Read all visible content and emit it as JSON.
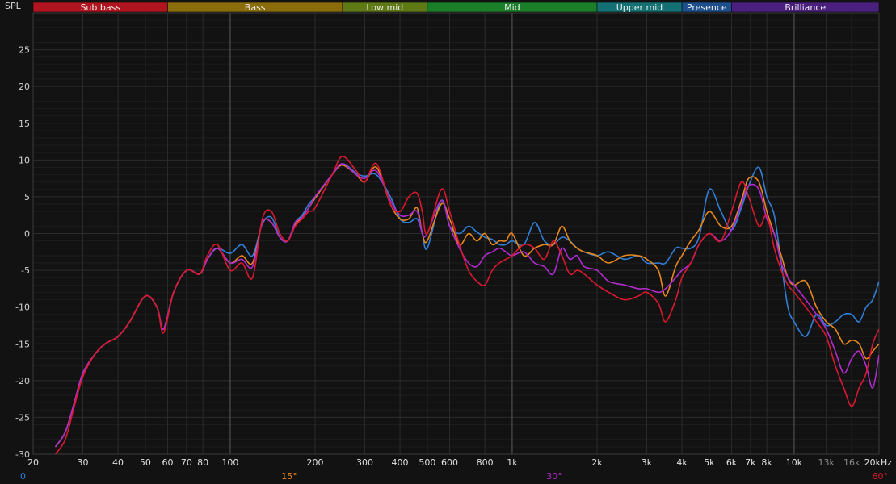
{
  "chart_data": {
    "type": "line",
    "ylabel": "SPL",
    "xlabel": "",
    "xscale": "log",
    "xlim": [
      20,
      20000
    ],
    "ylim": [
      -30,
      30
    ],
    "grid": true,
    "y_ticks": [
      25,
      20,
      15,
      10,
      5,
      0,
      -5,
      -10,
      -15,
      -20,
      -25,
      -30
    ],
    "x_ticks": [
      {
        "f": 20,
        "label": "20"
      },
      {
        "f": 30,
        "label": "30"
      },
      {
        "f": 40,
        "label": "40"
      },
      {
        "f": 50,
        "label": "50"
      },
      {
        "f": 60,
        "label": "60"
      },
      {
        "f": 70,
        "label": "70"
      },
      {
        "f": 80,
        "label": "80"
      },
      {
        "f": 100,
        "label": "100"
      },
      {
        "f": 200,
        "label": "200"
      },
      {
        "f": 300,
        "label": "300"
      },
      {
        "f": 400,
        "label": "400"
      },
      {
        "f": 500,
        "label": "500"
      },
      {
        "f": 600,
        "label": "600"
      },
      {
        "f": 800,
        "label": "800"
      },
      {
        "f": 1000,
        "label": "1k"
      },
      {
        "f": 2000,
        "label": "2k"
      },
      {
        "f": 3000,
        "label": "3k"
      },
      {
        "f": 4000,
        "label": "4k"
      },
      {
        "f": 5000,
        "label": "5k"
      },
      {
        "f": 6000,
        "label": "6k"
      },
      {
        "f": 7000,
        "label": "7k"
      },
      {
        "f": 8000,
        "label": "8k"
      },
      {
        "f": 10000,
        "label": "10k"
      },
      {
        "f": 13000,
        "label": "13k"
      },
      {
        "f": 16000,
        "label": "16k"
      },
      {
        "f": 20000,
        "label": "20kHz"
      }
    ],
    "bands": [
      {
        "label": "Sub bass",
        "from": 20,
        "to": 60,
        "color": "#b0141e"
      },
      {
        "label": "Bass",
        "from": 60,
        "to": 250,
        "color": "#8a6d0a"
      },
      {
        "label": "Low mid",
        "from": 250,
        "to": 500,
        "color": "#5f7a14"
      },
      {
        "label": "Mid",
        "from": 500,
        "to": 2000,
        "color": "#1b7f2a"
      },
      {
        "label": "Upper mid",
        "from": 2000,
        "to": 4000,
        "color": "#137073"
      },
      {
        "label": "Presence",
        "from": 4000,
        "to": 6000,
        "color": "#1c4f8c"
      },
      {
        "label": "Brilliance",
        "from": 6000,
        "to": 20000,
        "color": "#4a1f7e"
      }
    ],
    "legend": [
      {
        "label": "0",
        "color": "#2f7fd8"
      },
      {
        "label": "15°",
        "color": "#e8871a"
      },
      {
        "label": "30°",
        "color": "#b22ad0"
      },
      {
        "label": "60°",
        "color": "#d9192e"
      }
    ],
    "series": [
      {
        "color": "#2f7fd8",
        "x": [
          24,
          26,
          28,
          30,
          33,
          36,
          40,
          44,
          50,
          55,
          58,
          63,
          70,
          78,
          83,
          90,
          100,
          110,
          120,
          130,
          140,
          150,
          160,
          170,
          180,
          190,
          200,
          230,
          250,
          280,
          300,
          330,
          370,
          400,
          430,
          460,
          480,
          500,
          560,
          600,
          650,
          700,
          750,
          800,
          850,
          900,
          950,
          1000,
          1100,
          1200,
          1300,
          1400,
          1500,
          1600,
          1700,
          1800,
          2000,
          2200,
          2500,
          2800,
          3000,
          3300,
          3500,
          3800,
          4000,
          4300,
          4600,
          5000,
          5500,
          6000,
          6500,
          6900,
          7500,
          8000,
          8500,
          9000,
          9500,
          10000,
          11000,
          12000,
          13000,
          14000,
          15000,
          16000,
          17000,
          18000,
          19000,
          20000
        ],
        "y": [
          -29,
          -27,
          -23,
          -19,
          -16.5,
          -15,
          -14,
          -12,
          -8.5,
          -10,
          -13,
          -8,
          -5,
          -5.5,
          -3.5,
          -2,
          -2.7,
          -1.5,
          -3,
          1.3,
          2.2,
          -0.5,
          -1,
          1.5,
          2.5,
          4,
          5,
          8,
          9.5,
          8.2,
          7.8,
          8,
          5,
          2,
          1.5,
          2,
          0,
          -2,
          4.5,
          1,
          0,
          1,
          0.2,
          -0.5,
          -0.8,
          -1.5,
          -1.5,
          -1,
          -1.5,
          1.5,
          -1,
          -1.5,
          -0.5,
          -1,
          -2,
          -2.5,
          -3,
          -2.5,
          -3.5,
          -3,
          -4,
          -4,
          -4,
          -2,
          -2,
          -2,
          -0.5,
          6,
          3,
          0.5,
          3.5,
          6.5,
          9,
          5,
          2.5,
          -4,
          -10,
          -12,
          -14,
          -11,
          -12.5,
          -12,
          -11,
          -11,
          -12,
          -10,
          -9,
          -6.5
        ]
      },
      {
        "color": "#e8871a",
        "x": [
          24,
          26,
          28,
          30,
          33,
          36,
          40,
          44,
          50,
          55,
          58,
          63,
          70,
          78,
          83,
          90,
          100,
          110,
          120,
          130,
          140,
          150,
          160,
          170,
          180,
          190,
          200,
          230,
          250,
          280,
          300,
          330,
          370,
          400,
          430,
          460,
          480,
          500,
          560,
          600,
          650,
          700,
          750,
          800,
          850,
          900,
          950,
          1000,
          1100,
          1200,
          1300,
          1400,
          1500,
          1600,
          1700,
          1800,
          2000,
          2200,
          2500,
          2800,
          3000,
          3300,
          3500,
          3800,
          4000,
          4300,
          4600,
          5000,
          5500,
          6000,
          6500,
          6900,
          7500,
          8000,
          8500,
          9000,
          9500,
          10000,
          11000,
          12000,
          13000,
          14000,
          15000,
          16000,
          17000,
          18000,
          19000,
          20000
        ],
        "y": [
          -29,
          -27,
          -23,
          -19,
          -16.5,
          -15,
          -14,
          -12,
          -8.5,
          -10,
          -13,
          -8,
          -5,
          -5.5,
          -3.5,
          -2,
          -4,
          -3,
          -4,
          1.5,
          1.5,
          -0.5,
          -1,
          1.2,
          2.2,
          3.5,
          4.8,
          8,
          9.3,
          8,
          7,
          9,
          4,
          2,
          2,
          3.5,
          0,
          -1,
          4,
          2,
          -1.5,
          0,
          -1,
          0,
          -1.5,
          -1,
          -1,
          0,
          -3,
          -2,
          -1.5,
          -1.5,
          1,
          -1,
          -2,
          -2.5,
          -3,
          -4,
          -3,
          -3,
          -3.5,
          -5,
          -8.5,
          -4.5,
          -3,
          -1,
          0.5,
          3,
          1,
          1,
          4.5,
          7.5,
          7,
          3,
          0,
          -3,
          -6,
          -7,
          -6.5,
          -10,
          -12,
          -13,
          -15,
          -14.5,
          -15,
          -17,
          -16,
          -15
        ]
      },
      {
        "color": "#b22ad0",
        "x": [
          24,
          26,
          28,
          30,
          33,
          36,
          40,
          44,
          50,
          55,
          58,
          63,
          70,
          78,
          83,
          90,
          100,
          110,
          120,
          130,
          140,
          150,
          160,
          170,
          180,
          190,
          200,
          230,
          250,
          280,
          300,
          330,
          370,
          400,
          430,
          460,
          480,
          500,
          560,
          600,
          650,
          700,
          750,
          800,
          850,
          900,
          950,
          1000,
          1100,
          1200,
          1300,
          1400,
          1500,
          1600,
          1700,
          1800,
          2000,
          2200,
          2500,
          2800,
          3000,
          3300,
          3500,
          3800,
          4000,
          4300,
          4600,
          5000,
          5500,
          6000,
          6500,
          6900,
          7500,
          8000,
          8500,
          9000,
          9500,
          10000,
          11000,
          12000,
          13000,
          14000,
          15000,
          16000,
          17000,
          18000,
          19000,
          20000
        ],
        "y": [
          -29,
          -27,
          -23,
          -19,
          -16.5,
          -15,
          -14,
          -12,
          -8.5,
          -10,
          -13,
          -8,
          -5,
          -5.5,
          -3.5,
          -2,
          -4,
          -3.5,
          -4.5,
          1.5,
          1.5,
          -0.5,
          -1,
          1.5,
          2.2,
          3.5,
          5,
          8,
          9.5,
          8,
          7.5,
          8.5,
          4.5,
          2.5,
          2.5,
          3,
          0,
          0,
          4.5,
          1,
          -2,
          -4,
          -4.5,
          -3,
          -2.5,
          -2,
          -2.5,
          -3,
          -2.5,
          -4,
          -4.5,
          -5.5,
          -2,
          -3.5,
          -3,
          -4.5,
          -5,
          -6.5,
          -7,
          -7.5,
          -7.5,
          -8,
          -7.5,
          -6,
          -5,
          -4,
          -1.5,
          0,
          -1,
          0.5,
          4,
          6.5,
          6,
          2,
          0,
          -4,
          -6,
          -7,
          -9,
          -11,
          -13,
          -16,
          -19,
          -17,
          -16,
          -18,
          -21,
          -16.5
        ]
      },
      {
        "color": "#d9192e",
        "x": [
          24,
          26,
          28,
          30,
          33,
          36,
          40,
          44,
          50,
          55,
          58,
          63,
          70,
          78,
          83,
          90,
          100,
          110,
          120,
          130,
          140,
          150,
          160,
          170,
          180,
          190,
          200,
          230,
          250,
          280,
          300,
          330,
          370,
          400,
          430,
          460,
          480,
          500,
          560,
          600,
          650,
          700,
          750,
          800,
          850,
          900,
          950,
          1000,
          1100,
          1200,
          1300,
          1400,
          1500,
          1600,
          1700,
          1800,
          2000,
          2200,
          2500,
          2800,
          3000,
          3300,
          3500,
          3800,
          4000,
          4300,
          4600,
          5000,
          5500,
          6000,
          6500,
          6900,
          7500,
          8000,
          8500,
          9000,
          9500,
          10000,
          11000,
          12000,
          13000,
          14000,
          15000,
          16000,
          17000,
          18000,
          19000,
          20000
        ],
        "y": [
          -30,
          -28,
          -23.5,
          -19.5,
          -16.5,
          -15,
          -14,
          -12,
          -8.5,
          -10,
          -13.5,
          -8,
          -5,
          -5.5,
          -3,
          -1.5,
          -5,
          -4,
          -6,
          2,
          3,
          0,
          -1,
          1,
          2,
          3,
          3.5,
          8,
          10.5,
          8.5,
          7,
          9.5,
          4,
          3,
          5,
          5.5,
          3,
          0,
          6,
          3,
          -1.5,
          -5,
          -6.5,
          -7,
          -5,
          -4,
          -3.5,
          -3,
          -1.5,
          -2,
          -3.5,
          -1,
          -3,
          -5.5,
          -5,
          -5.5,
          -7,
          -8,
          -9,
          -8.5,
          -8,
          -9.5,
          -12,
          -9,
          -6,
          -4,
          -1.5,
          0,
          -1,
          3,
          7,
          5,
          1,
          2.5,
          -2,
          -5,
          -7,
          -8,
          -10,
          -12,
          -14,
          -18,
          -21,
          -23.5,
          -21,
          -19,
          -15,
          -13
        ]
      }
    ]
  }
}
